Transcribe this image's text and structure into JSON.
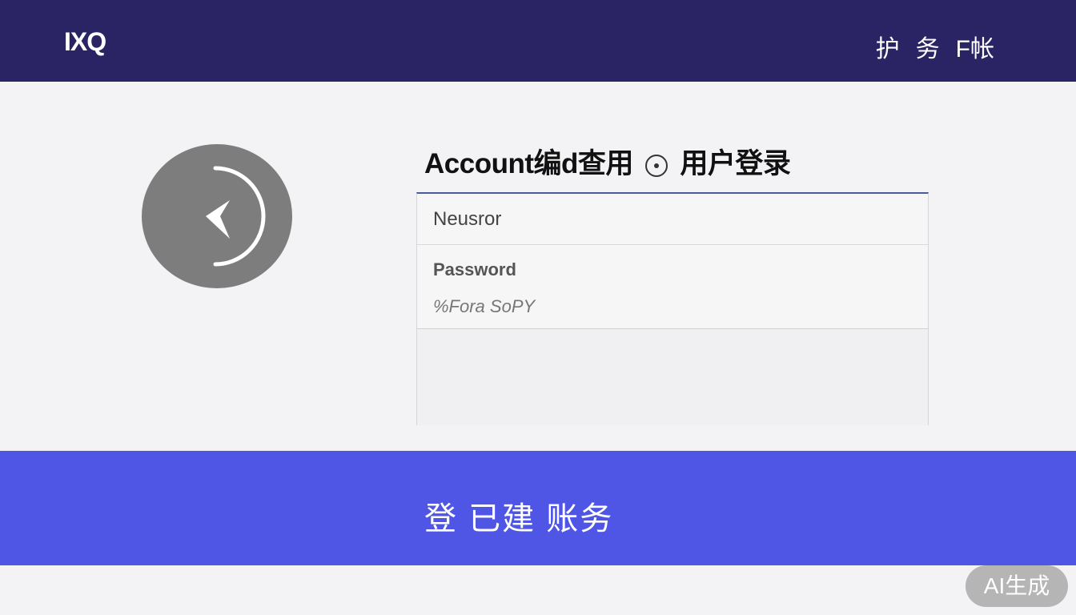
{
  "header": {
    "logo": "IXQ",
    "nav": [
      "护",
      "务",
      "F帐"
    ]
  },
  "form": {
    "title_start": "Account编d查用",
    "title_end": "用户登录",
    "username_placeholder": "Neusror",
    "password_label": "Password",
    "password_hint": "%Fora SoPY"
  },
  "submit": {
    "label": "登 已建 账务"
  },
  "badge": {
    "label": "AI生成"
  },
  "colors": {
    "header_bg": "#2a2465",
    "submit_bg": "#4f56e6",
    "page_bg": "#f3f3f5"
  },
  "icons": {
    "back": "back-arrow-icon",
    "title": "circle-dot-icon"
  }
}
